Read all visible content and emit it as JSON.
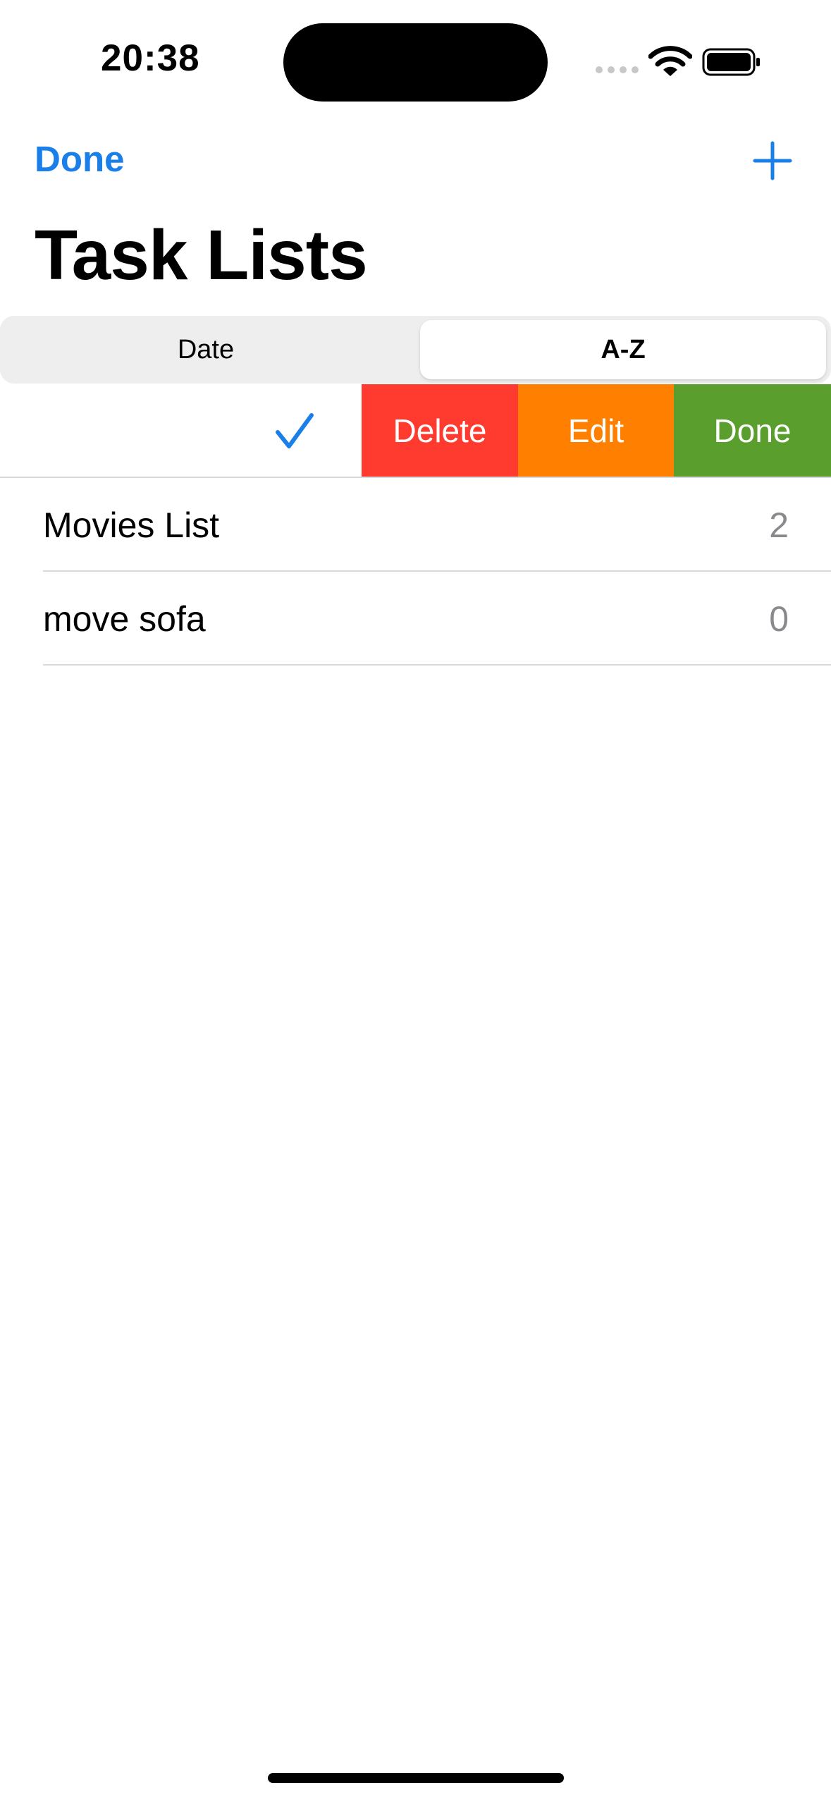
{
  "status_bar": {
    "time": "20:38"
  },
  "nav": {
    "done_label": "Done",
    "add_icon": "plus-icon",
    "title": "Task Lists"
  },
  "sort": {
    "options": [
      "Date",
      "A-Z"
    ],
    "selected": "A-Z"
  },
  "swipe_actions": [
    {
      "label": "Delete",
      "color": "#ff3b30"
    },
    {
      "label": "Edit",
      "color": "#ff7f00"
    },
    {
      "label": "Done",
      "color": "#5a9f2e"
    }
  ],
  "lists": [
    {
      "name": "Movies List",
      "count": "2"
    },
    {
      "name": "move sofa",
      "count": "0"
    }
  ],
  "colors": {
    "accent": "#1a7fe8",
    "secondary_text": "#8a8a8e"
  }
}
